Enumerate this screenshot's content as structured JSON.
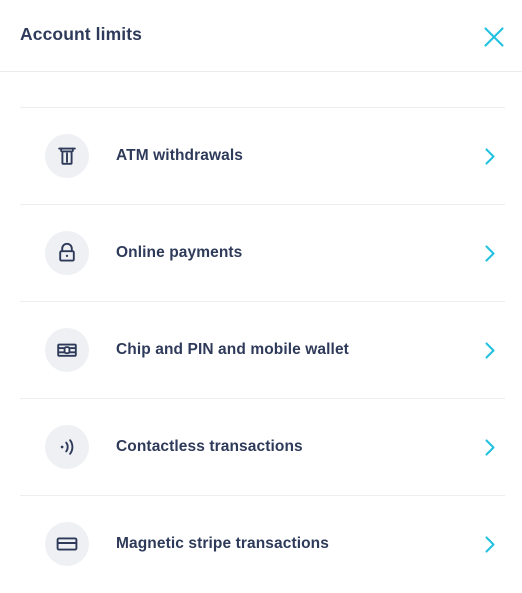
{
  "header": {
    "title": "Account limits",
    "close_icon": "close-icon"
  },
  "colors": {
    "title_text": "#2e3a59",
    "label_text": "#2e3a59",
    "accent_cyan": "#22c1e0",
    "icon_circle_bg": "#eef0f3",
    "divider": "#eceef0",
    "background": "#ffffff"
  },
  "list": {
    "items": [
      {
        "label": "ATM withdrawals",
        "icon": "atm-cash-dispenser-icon",
        "chevron": "chevron-right-icon"
      },
      {
        "label": "Online payments",
        "icon": "padlock-icon",
        "chevron": "chevron-right-icon"
      },
      {
        "label": "Chip and PIN and mobile wallet",
        "icon": "card-chip-icon",
        "chevron": "chevron-right-icon"
      },
      {
        "label": "Contactless transactions",
        "icon": "contactless-waves-icon",
        "chevron": "chevron-right-icon"
      },
      {
        "label": "Magnetic stripe transactions",
        "icon": "credit-card-stripe-icon",
        "chevron": "chevron-right-icon"
      }
    ]
  }
}
